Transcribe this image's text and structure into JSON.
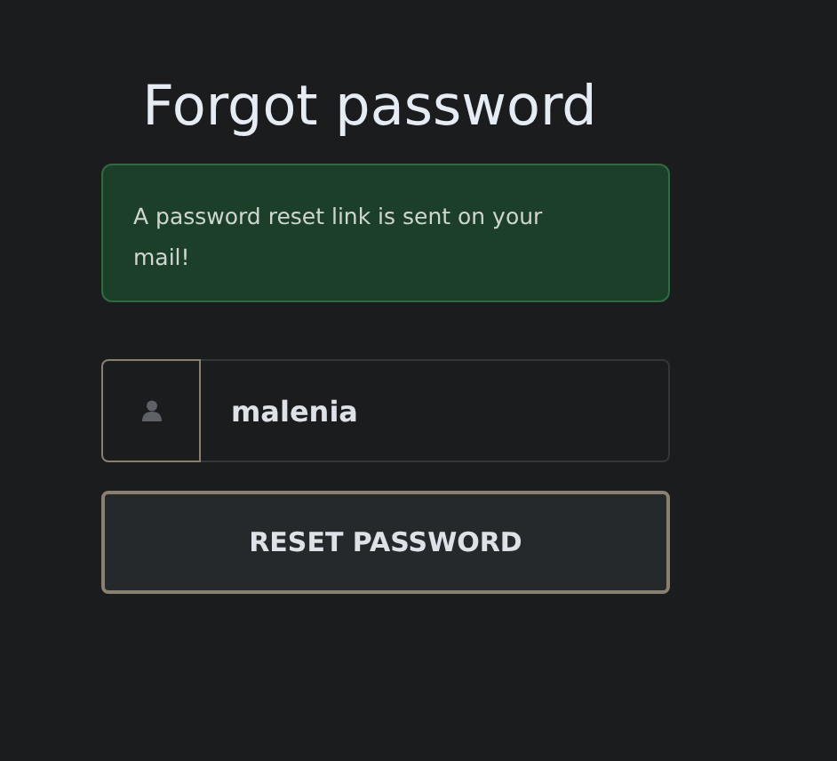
{
  "title": "Forgot password",
  "alert": {
    "message": "A password reset link is sent on your mail!"
  },
  "username_field": {
    "value": "malenia"
  },
  "submit_button": {
    "label": "RESET PASSWORD"
  }
}
